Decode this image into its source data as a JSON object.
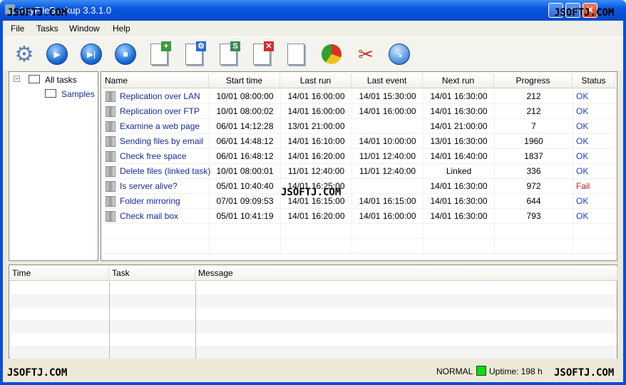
{
  "window": {
    "title": "AnyFileBackup 3.3.1.0",
    "minimize": "_",
    "maximize": "□",
    "close": "✕"
  },
  "menu": [
    "File",
    "Tasks",
    "Window",
    "Help"
  ],
  "toolbar": [
    "settings-icon",
    "run-icon",
    "run-next-icon",
    "stop-icon",
    "new-task-icon",
    "task-properties-icon",
    "copy-task-icon",
    "delete-task-icon",
    "task-log-icon",
    "statistics-icon",
    "tools-icon",
    "exit-icon"
  ],
  "tree": {
    "root": "All tasks",
    "child": "Samples"
  },
  "grid": {
    "columns": [
      "Name",
      "Start time",
      "Last run",
      "Last event",
      "Next run",
      "Progress",
      "Status"
    ],
    "rows": [
      {
        "icon": "folder-sync-icon",
        "name": "Replication over LAN",
        "start": "10/01 08:00:00",
        "last_run": "14/01 16:00:00",
        "last_event": "14/01 15:30:00",
        "next_run": "14/01 16:30:00",
        "progress": "212",
        "status": "OK"
      },
      {
        "icon": "network-icon",
        "name": "Replication over FTP",
        "start": "10/01 08:00:02",
        "last_run": "14/01 16:00:00",
        "last_event": "14/01 16:00:00",
        "next_run": "14/01 16:30:00",
        "progress": "212",
        "status": "OK"
      },
      {
        "icon": "web-icon",
        "name": "Examine a web page",
        "start": "06/01 14:12:28",
        "last_run": "13/01 21:00:00",
        "last_event": "",
        "next_run": "14/01 21:00:00",
        "progress": "7",
        "status": "OK"
      },
      {
        "icon": "folder-sync-icon",
        "name": "Sending files by email",
        "start": "06/01 14:48:12",
        "last_run": "14/01 16:10:00",
        "last_event": "14/01 10:00:00",
        "next_run": "13/01 16:30:00",
        "progress": "1960",
        "status": "OK"
      },
      {
        "icon": "disk-icon",
        "name": "Check free space",
        "start": "06/01 16:48:12",
        "last_run": "14/01 16:20:00",
        "last_event": "11/01 12:40:00",
        "next_run": "14/01 16:40:00",
        "progress": "1837",
        "status": "OK"
      },
      {
        "icon": "folder-sync-icon",
        "name": "Delete files (linked task)",
        "start": "10/01 08:00:01",
        "last_run": "11/01 12:40:00",
        "last_event": "11/01 12:40:00",
        "next_run": "Linked",
        "progress": "336",
        "status": "OK"
      },
      {
        "icon": "ping-icon",
        "name": "Is server alive?",
        "start": "05/01 10:40:40",
        "last_run": "14/01 16:25:00",
        "last_event": "",
        "next_run": "14/01 16:30:00",
        "progress": "972",
        "status": "Fail"
      },
      {
        "icon": "network-icon",
        "name": "Folder mirroring",
        "start": "07/01 09:09:53",
        "last_run": "14/01 16:15:00",
        "last_event": "14/01 16:15:00",
        "next_run": "14/01 16:30:00",
        "progress": "644",
        "status": "OK"
      },
      {
        "icon": "mail-icon",
        "name": "Check mail box",
        "start": "05/01 10:41:19",
        "last_run": "14/01 16:20:00",
        "last_event": "14/01 16:00:00",
        "next_run": "14/01 16:30:00",
        "progress": "793",
        "status": "OK"
      }
    ]
  },
  "log": {
    "columns": [
      "Time",
      "Task",
      "Message"
    ]
  },
  "status": {
    "mode": "NORMAL",
    "indicator_color": "#00e000",
    "uptime": "Uptime: 198 h"
  },
  "colors": {
    "ok": "#2040c0",
    "fail": "#c02020",
    "task_name": "#1a2a9a"
  },
  "watermarks": [
    "JSOFTJ.COM",
    "JSOFTJ.COM",
    "JSOFTJ.COM",
    "JSOFTJ.COM",
    "JSOFTJ.COM"
  ]
}
